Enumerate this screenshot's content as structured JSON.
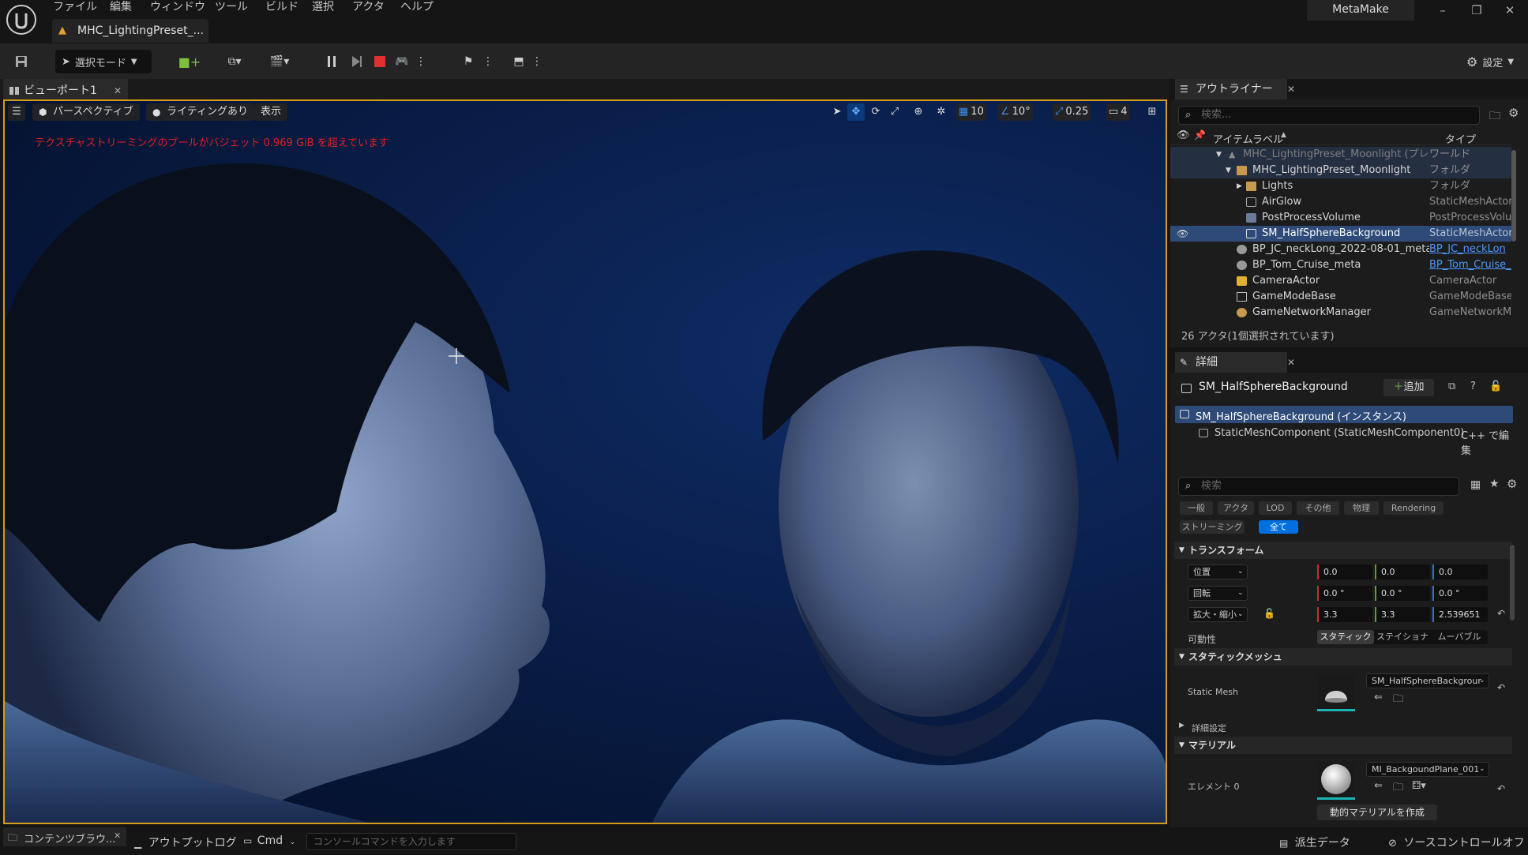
{
  "app": {
    "menu": [
      "ファイル",
      "編集",
      "ウィンドウ",
      "ツール",
      "ビルド",
      "選択",
      "アクタ",
      "ヘルプ"
    ],
    "doc_tab": "MHC_LightingPreset_...",
    "project_name": "MetaMake",
    "settings_label": "設定"
  },
  "toolbar": {
    "select_mode": "選択モード"
  },
  "viewport": {
    "tab": "ビューポート1",
    "perspective": "パースペクティブ",
    "lighting": "ライティングあり",
    "show": "表示",
    "grid_snap": "10",
    "rotate_snap": "10°",
    "scale_snap": "0.25",
    "camera_speed": "4",
    "warning": "テクスチャストリーミングのプールがバジェット 0.969 GiB を超えています"
  },
  "outliner": {
    "tab": "アウトライナー",
    "search_placeholder": "検索...",
    "col_label": "アイテムラベル",
    "col_type": "タイプ",
    "rows": [
      {
        "label": "MHC_LightingPreset_Moonlight (プレ",
        "type": "ワールド"
      },
      {
        "label": "MHC_LightingPreset_Moonlight",
        "type": "フォルダ"
      },
      {
        "label": "Lights",
        "type": "フォルダ"
      },
      {
        "label": "AirGlow",
        "type": "StaticMeshActor"
      },
      {
        "label": "PostProcessVolume",
        "type": "PostProcessVolu"
      },
      {
        "label": "SM_HalfSphereBackground",
        "type": "StaticMeshActor"
      },
      {
        "label": "BP_JC_neckLong_2022-08-01_meta",
        "type": "BP_JC_neckLon"
      },
      {
        "label": "BP_Tom_Cruise_meta",
        "type": "BP_Tom_Cruise_"
      },
      {
        "label": "CameraActor",
        "type": "CameraActor"
      },
      {
        "label": "GameModeBase",
        "type": "GameModeBase"
      },
      {
        "label": "GameNetworkManager",
        "type": "GameNetworkMa"
      }
    ],
    "status": "26 アクタ(1個選択されています)"
  },
  "details": {
    "tab": "詳細",
    "object_name": "SM_HalfSphereBackground",
    "add_button": "追加",
    "instance_label": "SM_HalfSphereBackground (インスタンス)",
    "component_label": "StaticMeshComponent (StaticMeshComponent0)",
    "edit_cpp": "C++ で編集",
    "search_placeholder": "検索",
    "categories": [
      "一般",
      "アクタ",
      "LOD",
      "その他",
      "物理",
      "Rendering",
      "ストリーミング",
      "全て"
    ],
    "transform_header": "トランスフォーム",
    "location": {
      "label": "位置",
      "x": "0.0",
      "y": "0.0",
      "z": "0.0"
    },
    "rotation": {
      "label": "回転",
      "x": "0.0 °",
      "y": "0.0 °",
      "z": "0.0 °"
    },
    "scale": {
      "label": "拡大・縮小",
      "x": "3.3",
      "y": "3.3",
      "z": "2.539651"
    },
    "mobility_label": "可動性",
    "mobility_options": [
      "スタティック",
      "ステイショナ",
      "ムーバブル"
    ],
    "static_mesh_header": "スタティックメッシュ",
    "static_mesh_label": "Static Mesh",
    "static_mesh_value": "SM_HalfSphereBackgrour",
    "advanced": "詳細設定",
    "material_header": "マテリアル",
    "element_label": "エレメント 0",
    "material_value": "MI_BackgoundPlane_001",
    "dynamic_material": "動的マテリアルを作成"
  },
  "bottom": {
    "content_browser": "コンテンツブラウ...",
    "output_log": "アウトプットログ",
    "cmd": "Cmd",
    "console_placeholder": "コンソールコマンドを入力します",
    "derived_data": "派生データ",
    "source_control": "ソースコントロールオフ"
  },
  "colors": {
    "accent": "#0070e0",
    "selection": "#2d4a78",
    "viewport_border": "#d49c18",
    "warning": "#e02020"
  }
}
